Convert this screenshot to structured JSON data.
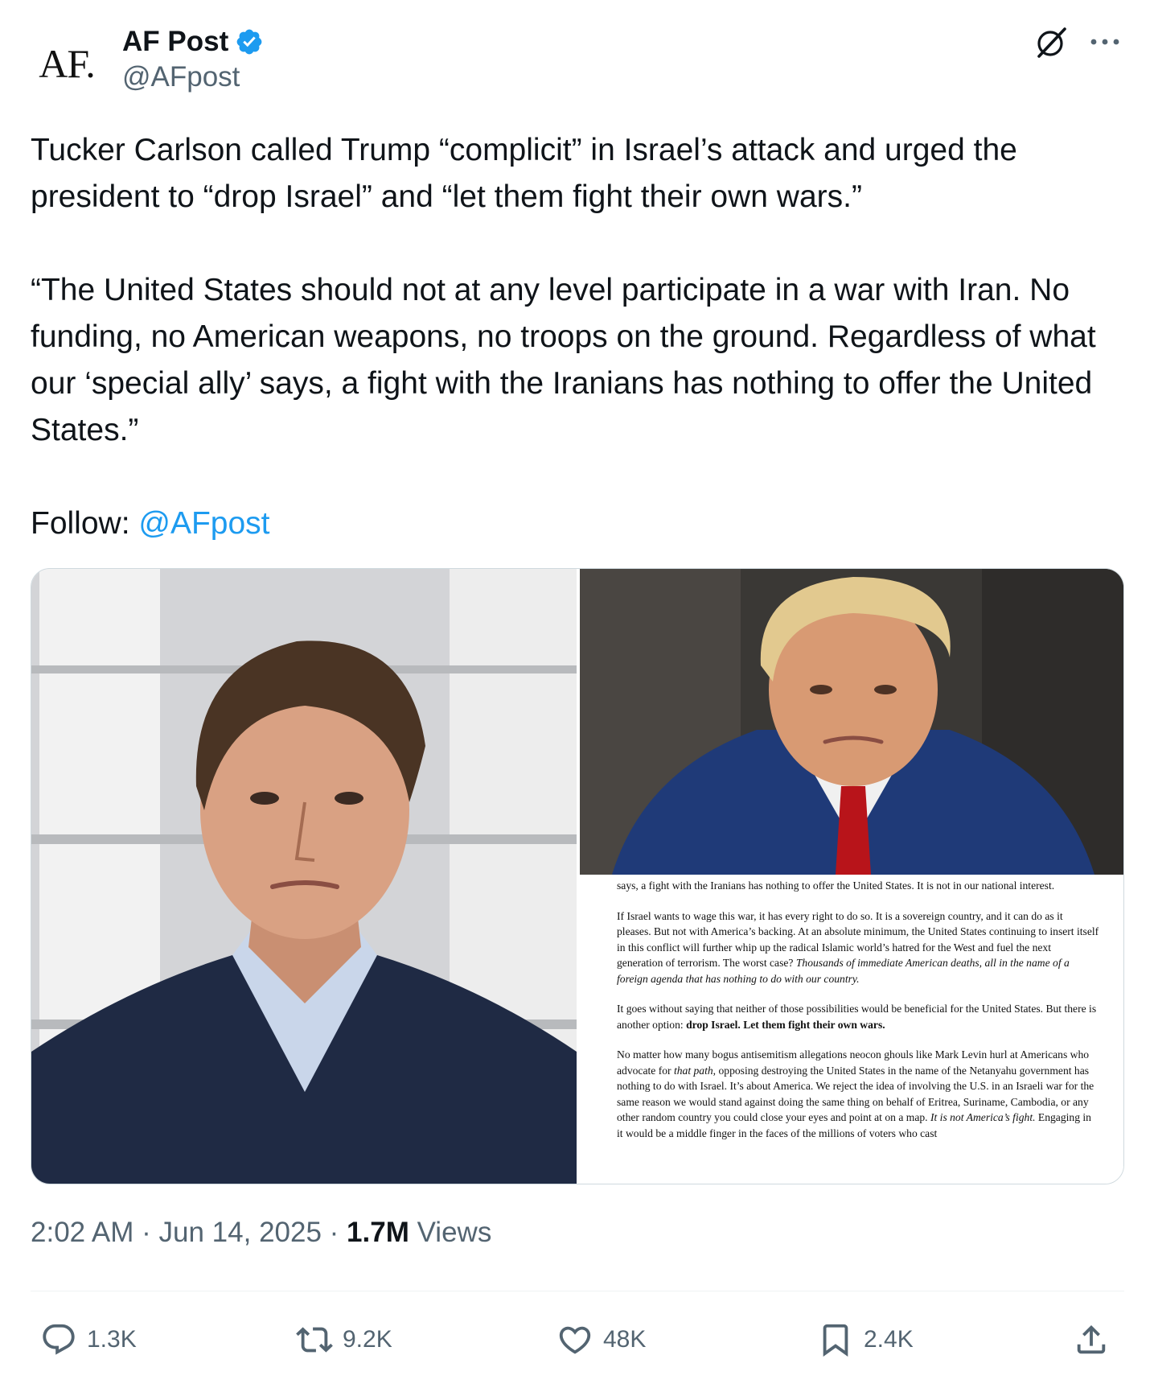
{
  "author": {
    "display_name": "AF Post",
    "handle": "@AFpost",
    "avatar_text": "AF."
  },
  "tweet": {
    "paragraph_1": "Tucker Carlson called Trump “complicit” in Israel’s attack and urged the president to “drop Israel” and “let them fight their own wars.”",
    "paragraph_2": "“The United States should not at any level participate in a war with Iran. No funding, no American weapons, no troops on the ground. Regardless of what our ‘special ally’ says, a fight with the Iranians has nothing to offer the United States.”",
    "follow_label": "Follow: ",
    "follow_mention": "@AFpost"
  },
  "media": {
    "left_photo_icon": "photo-portrait",
    "right_photo_icon": "photo-portrait",
    "document": {
      "p1": "says, a fight with the Iranians has nothing to offer the United States. It is not in our national interest.",
      "p2_a": "If Israel wants to wage this war, it has every right to do so. It is a sovereign country, and it can do as it pleases. But not with America’s backing. At an absolute minimum, the United States continuing to insert itself in this conflict will further whip up the radical Islamic world’s hatred for the West and fuel the next generation of terrorism. The worst case? ",
      "p2_b": "Thousands of immediate American deaths, all in the name of a foreign agenda that has nothing to do with our country.",
      "p3_a": "It goes without saying that neither of those possibilities would be beneficial for the United States. But there is another option: ",
      "p3_b": "drop Israel. Let them fight their own wars.",
      "p4_a": "No matter how many bogus antisemitism allegations neocon ghouls like Mark Levin hurl at Americans who advocate for ",
      "p4_b": "that path",
      "p4_c": ", opposing destroying the United States in the name of the Netanyahu government has nothing to do with Israel. It’s about America. We reject the idea of involving the U.S. in an Israeli war for the same reason we would stand against doing the same thing on behalf of Eritrea, Suriname, Cambodia, or any other random country you could close your eyes and point at on a map. ",
      "p4_d": "It is not America’s fight.",
      "p4_e": " Engaging in it would be a middle finger in the faces of the millions of voters who cast"
    }
  },
  "meta": {
    "time": "2:02 AM",
    "separator": " · ",
    "date": "Jun 14, 2025",
    "views_count": "1.7M",
    "views_label": " Views"
  },
  "actions": {
    "replies": "1.3K",
    "reposts": "9.2K",
    "likes": "48K",
    "bookmarks": "2.4K"
  },
  "colors": {
    "accent": "#1d9bf0",
    "text": "#0f1419",
    "secondary": "#536471",
    "divider": "#eff3f4"
  }
}
